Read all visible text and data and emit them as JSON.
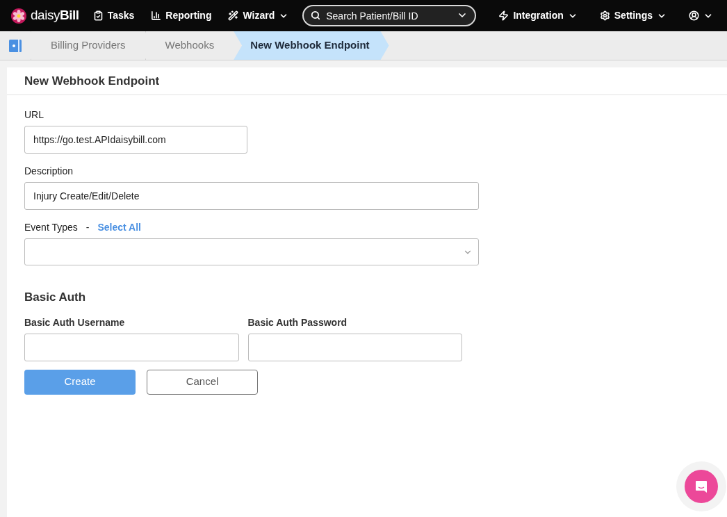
{
  "brand": {
    "name": "daisy",
    "name_bold": "Bill"
  },
  "nav": [
    {
      "label": "Tasks",
      "kind": "tasks",
      "dropdown": false
    },
    {
      "label": "Reporting",
      "kind": "reporting",
      "dropdown": false
    },
    {
      "label": "Wizard",
      "kind": "wizard",
      "dropdown": true
    }
  ],
  "search": {
    "placeholder": "Search Patient/Bill ID"
  },
  "nav_right": [
    {
      "label": "Integration",
      "kind": "integration",
      "dropdown": true
    },
    {
      "label": "Settings",
      "kind": "settings",
      "dropdown": true
    },
    {
      "kind": "account",
      "dropdown": true
    }
  ],
  "breadcrumbs": [
    {
      "label": "Billing Providers",
      "selected": false
    },
    {
      "label": "Webhooks",
      "selected": false
    },
    {
      "label": "New Webhook Endpoint",
      "selected": true
    }
  ],
  "form": {
    "title": "New Webhook Endpoint",
    "url": {
      "label": "URL",
      "value": "https://go.test.APIdaisybill.com"
    },
    "description": {
      "label": "Description",
      "value": "Injury Create/Edit/Delete"
    },
    "event_types": {
      "label": "Event Types",
      "separator": "-",
      "link": "Select All"
    },
    "basic_auth": {
      "title": "Basic Auth",
      "username_label": "Basic Auth Username",
      "password_label": "Basic Auth Password"
    },
    "buttons": [
      {
        "label": "Create",
        "kind": "primary"
      },
      {
        "label": "Cancel",
        "kind": "secondary"
      }
    ]
  }
}
